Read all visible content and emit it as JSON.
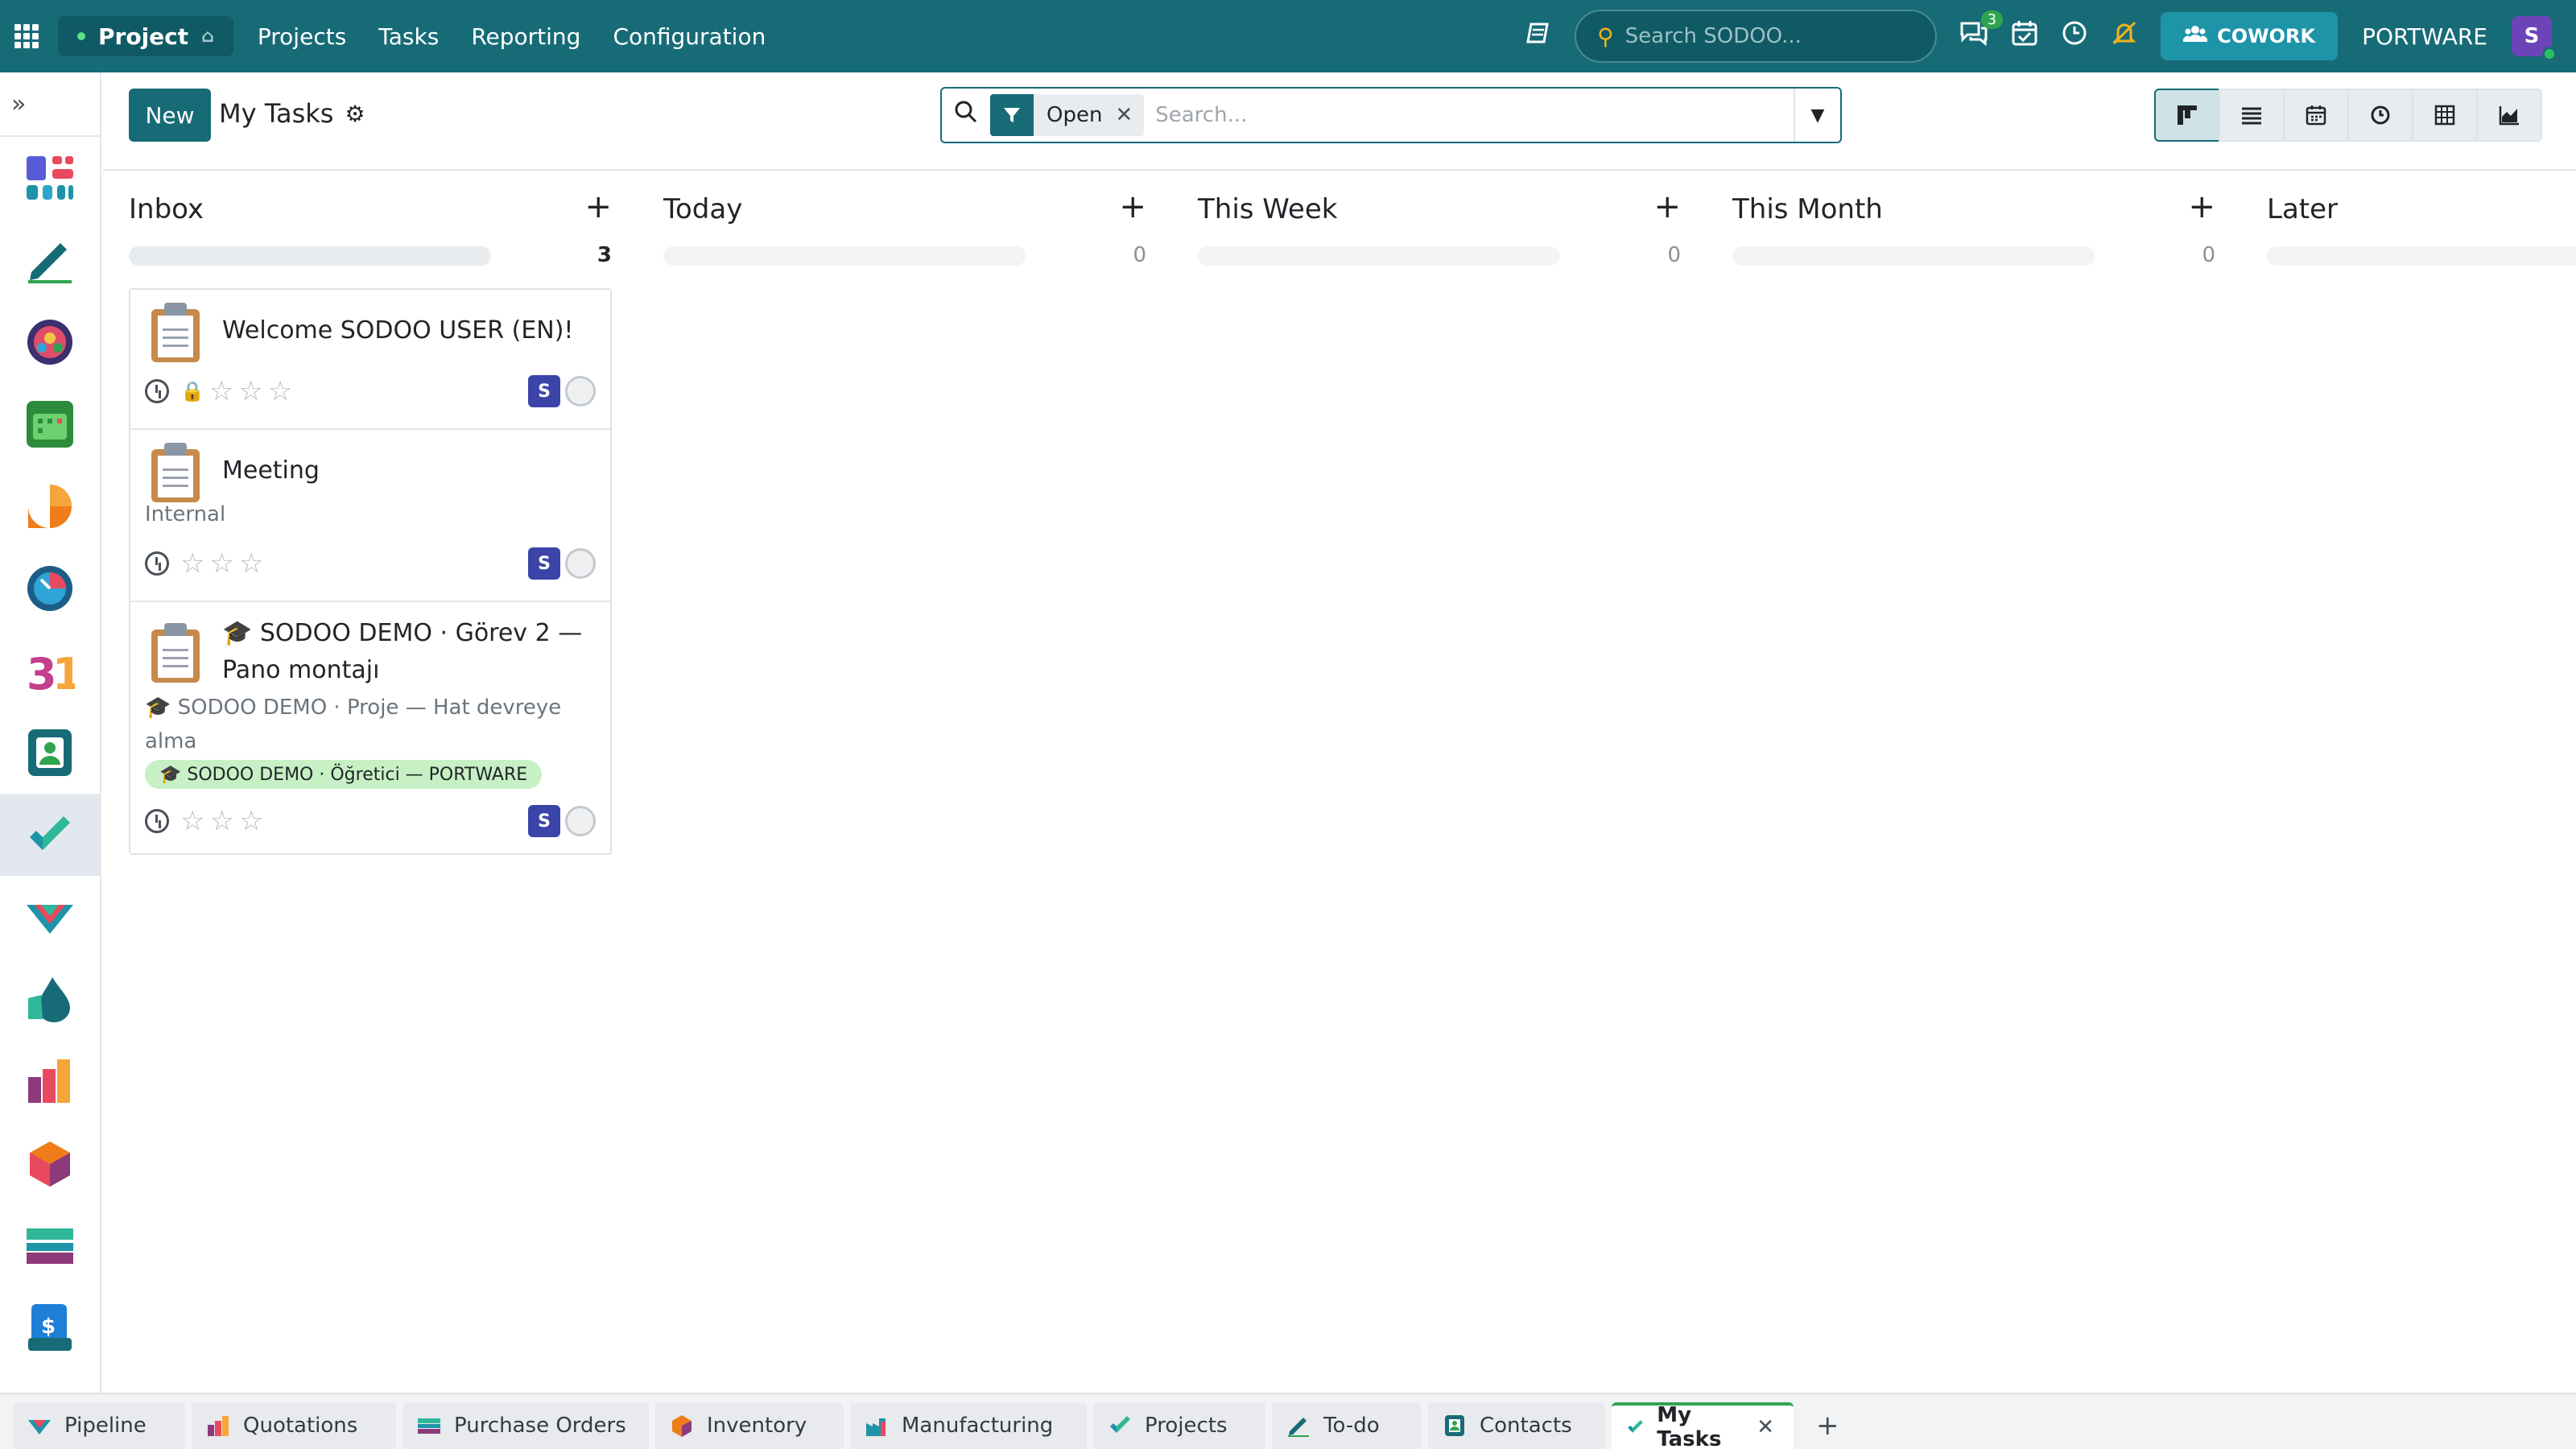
{
  "topbar": {
    "app_name": "Project",
    "menu": [
      "Projects",
      "Tasks",
      "Reporting",
      "Configuration"
    ],
    "search_placeholder": "Search SODOO...",
    "messages_count": "3",
    "cowork_label": "COWORK",
    "company": "PORTWARE",
    "user_initial": "S"
  },
  "control": {
    "new_label": "New",
    "breadcrumb": "My Tasks",
    "facet_label": "Open",
    "search_placeholder": "Search..."
  },
  "columns": [
    {
      "title": "Inbox",
      "count": "3"
    },
    {
      "title": "Today",
      "count": "0"
    },
    {
      "title": "This Week",
      "count": "0"
    },
    {
      "title": "This Month",
      "count": "0"
    },
    {
      "title": "Later",
      "count": ""
    }
  ],
  "cards": [
    {
      "title": "Welcome SODOO USER (EN)!",
      "assignee": "S"
    },
    {
      "title": "Meeting",
      "subtitle": "Internal",
      "assignee": "S"
    },
    {
      "title_line1": "🎓 SODOO DEMO · Görev 2 —",
      "title_line2": "Pano montajı",
      "subtitle_line1": "🎓 SODOO DEMO · Proje — Hat devreye",
      "subtitle_line2": "alma",
      "tag": "🎓 SODOO DEMO · Öğretici — PORTWARE",
      "assignee": "S"
    }
  ],
  "tabs": [
    {
      "label": "Pipeline"
    },
    {
      "label": "Quotations"
    },
    {
      "label": "Purchase Orders"
    },
    {
      "label": "Inventory"
    },
    {
      "label": "Manufacturing"
    },
    {
      "label": "Projects"
    },
    {
      "label": "To-do"
    },
    {
      "label": "Contacts"
    },
    {
      "label": "My Tasks"
    }
  ],
  "colors": {
    "brand": "#176b77",
    "tag_green": "#c7f0c4",
    "avatar": "#3b45a8"
  }
}
